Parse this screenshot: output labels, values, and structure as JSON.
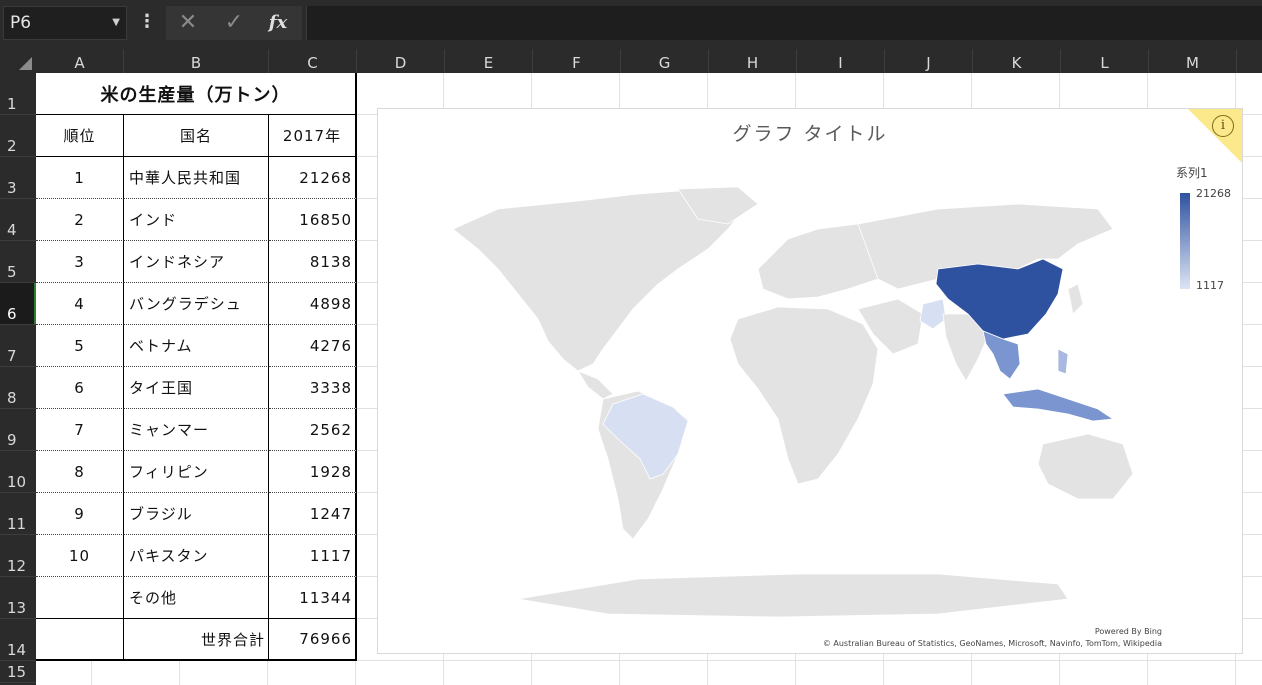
{
  "formula_bar": {
    "name_box": "P6",
    "cancel_icon": "✕",
    "enter_icon": "✓",
    "function_icon": "fx",
    "formula": ""
  },
  "columns": [
    "A",
    "B",
    "C",
    "D",
    "E",
    "F",
    "G",
    "H",
    "I",
    "J",
    "K",
    "L",
    "M"
  ],
  "rows": [
    "1",
    "2",
    "3",
    "4",
    "5",
    "6",
    "7",
    "8",
    "9",
    "10",
    "11",
    "12",
    "13",
    "14",
    "15"
  ],
  "selected_row": "6",
  "table": {
    "title": "米の生産量（万トン）",
    "headers": [
      "順位",
      "国名",
      "2017年"
    ],
    "rows": [
      {
        "rank": "1",
        "country": "中華人民共和国",
        "value": "21268"
      },
      {
        "rank": "2",
        "country": "インド",
        "value": "16850"
      },
      {
        "rank": "3",
        "country": "インドネシア",
        "value": "8138"
      },
      {
        "rank": "4",
        "country": "バングラデシュ",
        "value": "4898"
      },
      {
        "rank": "5",
        "country": "ベトナム",
        "value": "4276"
      },
      {
        "rank": "6",
        "country": "タイ王国",
        "value": "3338"
      },
      {
        "rank": "7",
        "country": "ミャンマー",
        "value": "2562"
      },
      {
        "rank": "8",
        "country": "フィリピン",
        "value": "1928"
      },
      {
        "rank": "9",
        "country": "ブラジル",
        "value": "1247"
      },
      {
        "rank": "10",
        "country": "パキスタン",
        "value": "1117"
      },
      {
        "rank": "",
        "country": "その他",
        "value": "11344"
      }
    ],
    "total_label": "世界合計",
    "total_value": "76966"
  },
  "chart": {
    "title": "グラフ タイトル",
    "legend_series": "系列1",
    "legend_max": "21268",
    "legend_min": "1117",
    "info_icon": "i",
    "credit_line1": "Powered By Bing",
    "credit_line2": "© Australian Bureau of Statistics, GeoNames, Microsoft, Navinfo, TomTom, Wikipedia",
    "colors": {
      "land": "#e3e3e3",
      "high": "#2f52a0",
      "mid": "#7a95cf",
      "low": "#d7e0f2"
    }
  }
}
